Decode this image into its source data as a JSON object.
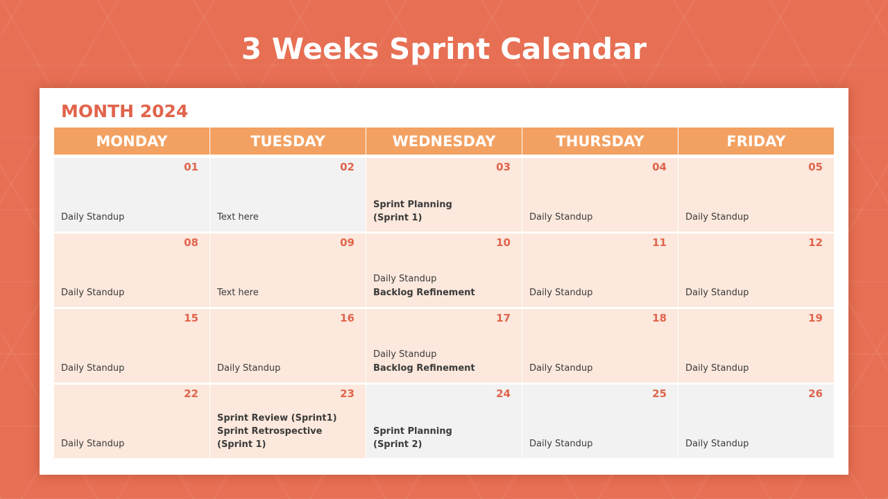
{
  "title": "3 Weeks Sprint Calendar",
  "month_label": "MONTH 2024",
  "colors": {
    "background": "#e76f53",
    "accent": "#e0644c",
    "header": "#f3a162",
    "cell_peach": "#fce8dc",
    "cell_grey": "#f2f2f2"
  },
  "weekdays": [
    "MONDAY",
    "TUESDAY",
    "WEDNESDAY",
    "THURSDAY",
    "FRIDAY"
  ],
  "weeks": [
    {
      "days": [
        {
          "num": "01",
          "shade": "grey",
          "events": [
            {
              "text": "Daily Standup",
              "bold": false
            }
          ]
        },
        {
          "num": "02",
          "shade": "grey",
          "events": [
            {
              "text": "Text here",
              "bold": false
            }
          ]
        },
        {
          "num": "03",
          "shade": "peach",
          "events": [
            {
              "text": "Sprint Planning",
              "bold": true
            },
            {
              "text": "(Sprint 1)",
              "bold": true
            }
          ]
        },
        {
          "num": "04",
          "shade": "peach",
          "events": [
            {
              "text": "Daily Standup",
              "bold": false
            }
          ]
        },
        {
          "num": "05",
          "shade": "peach",
          "events": [
            {
              "text": "Daily Standup",
              "bold": false
            }
          ]
        }
      ]
    },
    {
      "days": [
        {
          "num": "08",
          "shade": "peach",
          "events": [
            {
              "text": "Daily Standup",
              "bold": false
            }
          ]
        },
        {
          "num": "09",
          "shade": "peach",
          "events": [
            {
              "text": "Text here",
              "bold": false
            }
          ]
        },
        {
          "num": "10",
          "shade": "peach",
          "events": [
            {
              "text": "Daily Standup",
              "bold": false
            },
            {
              "text": "Backlog Refinement",
              "bold": true
            }
          ]
        },
        {
          "num": "11",
          "shade": "peach",
          "events": [
            {
              "text": "Daily Standup",
              "bold": false
            }
          ]
        },
        {
          "num": "12",
          "shade": "peach",
          "events": [
            {
              "text": "Daily Standup",
              "bold": false
            }
          ]
        }
      ]
    },
    {
      "days": [
        {
          "num": "15",
          "shade": "peach",
          "events": [
            {
              "text": "Daily Standup",
              "bold": false
            }
          ]
        },
        {
          "num": "16",
          "shade": "peach",
          "events": [
            {
              "text": "Daily Standup",
              "bold": false
            }
          ]
        },
        {
          "num": "17",
          "shade": "peach",
          "events": [
            {
              "text": "Daily Standup",
              "bold": false
            },
            {
              "text": "Backlog Refinement",
              "bold": true
            }
          ]
        },
        {
          "num": "18",
          "shade": "peach",
          "events": [
            {
              "text": "Daily Standup",
              "bold": false
            }
          ]
        },
        {
          "num": "19",
          "shade": "peach",
          "events": [
            {
              "text": "Daily Standup",
              "bold": false
            }
          ]
        }
      ]
    },
    {
      "days": [
        {
          "num": "22",
          "shade": "peach",
          "events": [
            {
              "text": "Daily Standup",
              "bold": false
            }
          ]
        },
        {
          "num": "23",
          "shade": "peach",
          "events": [
            {
              "text": "Sprint Review (Sprint1)",
              "bold": true
            },
            {
              "text": "Sprint Retrospective",
              "bold": true
            },
            {
              "text": "(Sprint 1)",
              "bold": true
            }
          ]
        },
        {
          "num": "24",
          "shade": "grey",
          "events": [
            {
              "text": "Sprint Planning",
              "bold": true
            },
            {
              "text": "(Sprint 2)",
              "bold": true
            }
          ]
        },
        {
          "num": "25",
          "shade": "grey",
          "events": [
            {
              "text": "Daily Standup",
              "bold": false
            }
          ]
        },
        {
          "num": "26",
          "shade": "grey",
          "events": [
            {
              "text": "Daily Standup",
              "bold": false
            }
          ]
        }
      ]
    }
  ]
}
